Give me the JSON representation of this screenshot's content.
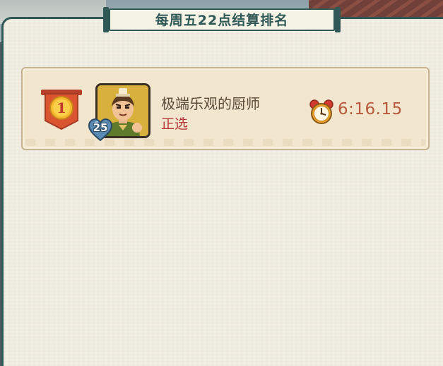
{
  "header": {
    "title": "每周五22点结算排名"
  },
  "ranking": {
    "entries": [
      {
        "rank": "1",
        "level": "25",
        "player_name": "极端乐观的厨师",
        "status": "正选",
        "time": "6:16.15",
        "icons": {
          "rank": "rank-medal-icon",
          "avatar": "chef-avatar",
          "level": "heart-level-badge-icon",
          "time": "alarm-clock-icon"
        }
      }
    ]
  },
  "colors": {
    "panel_border": "#2f5856",
    "panel_bg": "#f1eee4",
    "card_bg": "#f2e6cf",
    "status": "#b8383a",
    "time": "#b85a3c",
    "medal": "#d9542f"
  }
}
